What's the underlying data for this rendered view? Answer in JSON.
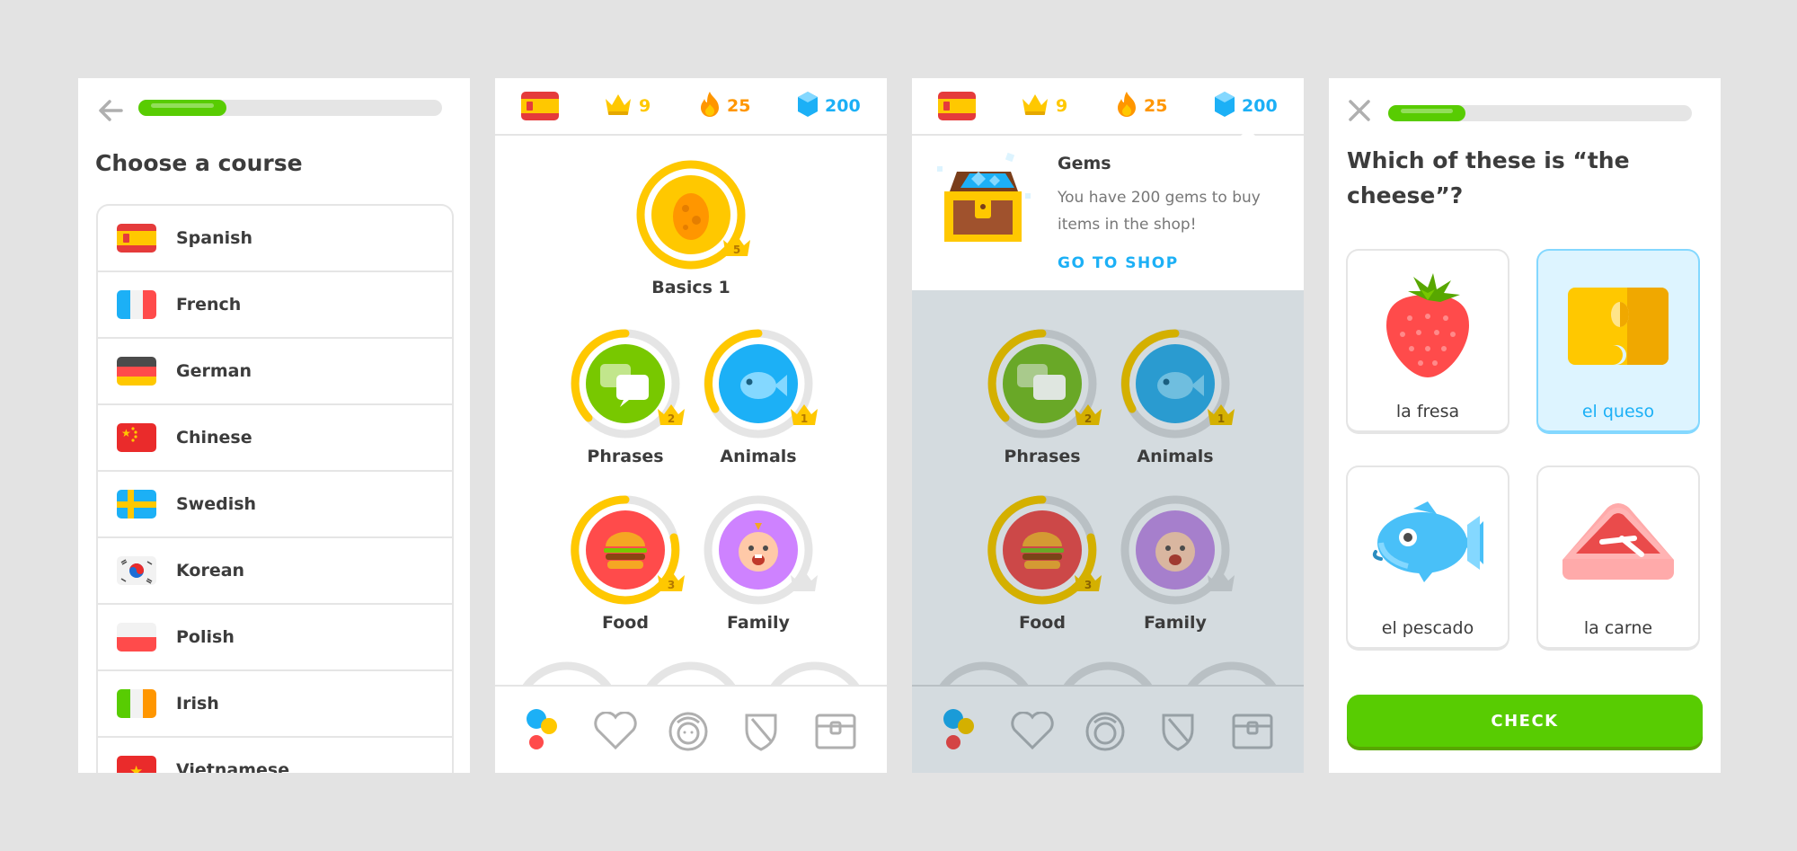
{
  "course_picker": {
    "title": "Choose a course",
    "progress": 0.29,
    "courses": [
      {
        "label": "Spanish",
        "flag": "es"
      },
      {
        "label": "French",
        "flag": "fr"
      },
      {
        "label": "German",
        "flag": "de"
      },
      {
        "label": "Chinese",
        "flag": "cn"
      },
      {
        "label": "Swedish",
        "flag": "se"
      },
      {
        "label": "Korean",
        "flag": "kr"
      },
      {
        "label": "Polish",
        "flag": "pl"
      },
      {
        "label": "Irish",
        "flag": "ie"
      },
      {
        "label": "Vietnamese",
        "flag": "vn"
      }
    ]
  },
  "stats": {
    "crowns": "9",
    "streak": "25",
    "gems": "200",
    "crown_color": "#ffc800",
    "streak_color": "#ff9600",
    "gem_color": "#1cb0f6"
  },
  "skill_tree": {
    "skills": [
      {
        "label": "Basics 1",
        "level": "5",
        "icon": "egg-icon",
        "color": "#ffc800"
      },
      {
        "label": "Phrases",
        "level": "2",
        "icon": "speech-bubbles-icon",
        "color": "#78c800"
      },
      {
        "label": "Animals",
        "level": "1",
        "icon": "fish-icon",
        "color": "#1cb0f6"
      },
      {
        "label": "Food",
        "level": "3",
        "icon": "burger-icon",
        "color": "#ff4b4b"
      },
      {
        "label": "Family",
        "level": "",
        "icon": "baby-icon",
        "color": "#ce82ff"
      }
    ]
  },
  "gems_popup": {
    "title": "Gems",
    "text": "You have 200 gems to buy items in the shop!",
    "link": "GO TO SHOP"
  },
  "question": {
    "progress": 0.25,
    "prompt": "Which of these is “the cheese”?",
    "options": [
      {
        "label": "la fresa",
        "icon": "strawberry-icon",
        "selected": false
      },
      {
        "label": "el queso",
        "icon": "cheese-icon",
        "selected": true
      },
      {
        "label": "el pescado",
        "icon": "fish-icon",
        "selected": false
      },
      {
        "label": "la carne",
        "icon": "meat-icon",
        "selected": false
      }
    ],
    "check_label": "CHECK"
  },
  "bottom_nav": [
    "learn-icon",
    "heart-icon",
    "profile-icon",
    "shield-icon",
    "chest-icon"
  ]
}
